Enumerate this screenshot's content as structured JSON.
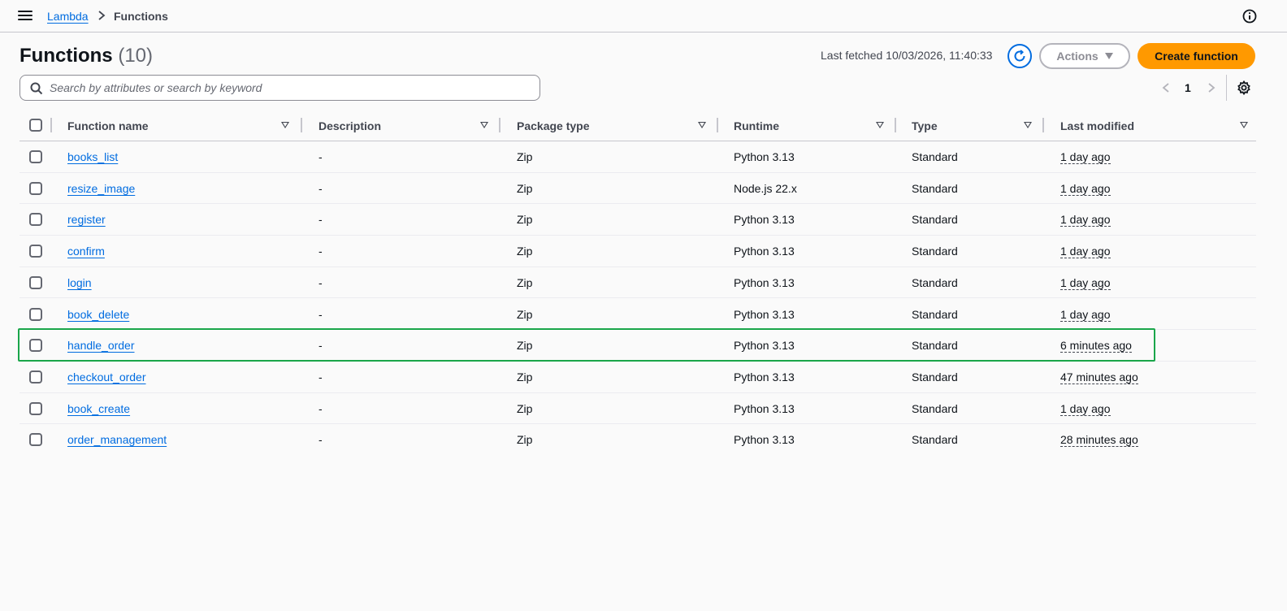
{
  "breadcrumb": {
    "service": "Lambda",
    "current": "Functions"
  },
  "header": {
    "title": "Functions",
    "count": "(10)",
    "last_fetched": "Last fetched 10/03/2026, 11:40:33",
    "actions_label": "Actions",
    "create_label": "Create function"
  },
  "search": {
    "placeholder": "Search by attributes or search by keyword",
    "value": ""
  },
  "pagination": {
    "current_page": "1"
  },
  "table": {
    "columns": [
      "Function name",
      "Description",
      "Package type",
      "Runtime",
      "Type",
      "Last modified"
    ],
    "rows": [
      {
        "name": "books_list",
        "description": "-",
        "package": "Zip",
        "runtime": "Python 3.13",
        "type": "Standard",
        "modified": "1 day ago"
      },
      {
        "name": "resize_image",
        "description": "-",
        "package": "Zip",
        "runtime": "Node.js 22.x",
        "type": "Standard",
        "modified": "1 day ago"
      },
      {
        "name": "register",
        "description": "-",
        "package": "Zip",
        "runtime": "Python 3.13",
        "type": "Standard",
        "modified": "1 day ago"
      },
      {
        "name": "confirm",
        "description": "-",
        "package": "Zip",
        "runtime": "Python 3.13",
        "type": "Standard",
        "modified": "1 day ago"
      },
      {
        "name": "login",
        "description": "-",
        "package": "Zip",
        "runtime": "Python 3.13",
        "type": "Standard",
        "modified": "1 day ago"
      },
      {
        "name": "book_delete",
        "description": "-",
        "package": "Zip",
        "runtime": "Python 3.13",
        "type": "Standard",
        "modified": "1 day ago"
      },
      {
        "name": "handle_order",
        "description": "-",
        "package": "Zip",
        "runtime": "Python 3.13",
        "type": "Standard",
        "modified": "6 minutes ago"
      },
      {
        "name": "checkout_order",
        "description": "-",
        "package": "Zip",
        "runtime": "Python 3.13",
        "type": "Standard",
        "modified": "47 minutes ago"
      },
      {
        "name": "book_create",
        "description": "-",
        "package": "Zip",
        "runtime": "Python 3.13",
        "type": "Standard",
        "modified": "1 day ago"
      },
      {
        "name": "order_management",
        "description": "-",
        "package": "Zip",
        "runtime": "Python 3.13",
        "type": "Standard",
        "modified": "28 minutes ago"
      }
    ]
  },
  "colors": {
    "link": "#006ce0",
    "primary_button": "#ff9900",
    "highlight_box": "#1aa64a"
  },
  "icons": [
    "hamburger-icon",
    "chevron-right-icon",
    "info-icon",
    "refresh-icon",
    "caret-down-icon",
    "search-icon",
    "chevron-left-icon",
    "gear-icon",
    "sort-icon"
  ]
}
